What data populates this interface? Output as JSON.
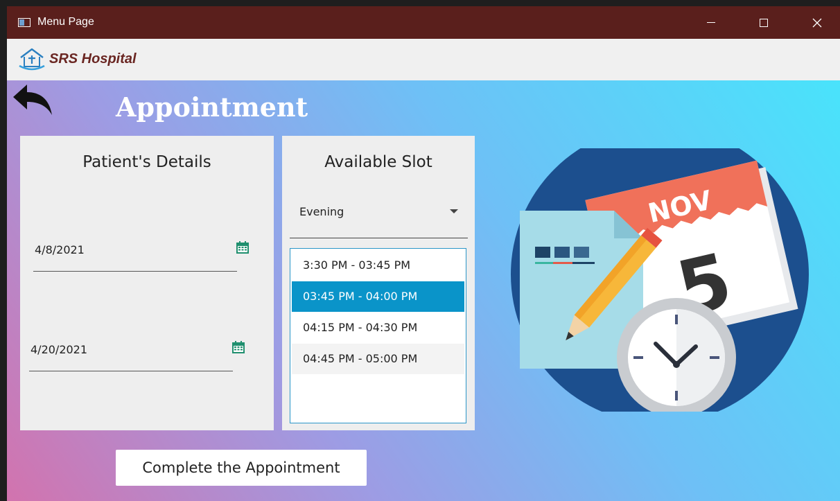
{
  "window": {
    "title": "Menu Page",
    "controls": {
      "minimize": "minimize",
      "maximize": "maximize",
      "close": "close"
    }
  },
  "brand": {
    "name": "SRS Hospital",
    "logo_icon": "hospital-house-icon"
  },
  "page": {
    "title": "Appointment",
    "back_icon": "back-arrow-icon"
  },
  "patient_panel": {
    "title": "Patient's Details",
    "date1": "4/8/2021",
    "date2": "4/20/2021",
    "date_icon": "calendar-icon"
  },
  "slot_panel": {
    "title": "Available Slot",
    "period_selected": "Evening",
    "slots": [
      {
        "label": "3:30 PM - 03:45 PM",
        "selected": false
      },
      {
        "label": "03:45 PM - 04:00 PM",
        "selected": true
      },
      {
        "label": "04:15 PM - 04:30 PM",
        "selected": false
      },
      {
        "label": "04:45 PM - 05:00 PM",
        "selected": false
      }
    ]
  },
  "actions": {
    "complete_label": "Complete the Appointment"
  },
  "illustration": {
    "month": "NOV",
    "day": "5"
  },
  "colors": {
    "titlebar": "#5a1f1c",
    "brand_text": "#6a2622",
    "selected_item": "#0a94c9",
    "listbox_border": "#2a96c8",
    "calendar_icon": "#1f8f6e"
  }
}
